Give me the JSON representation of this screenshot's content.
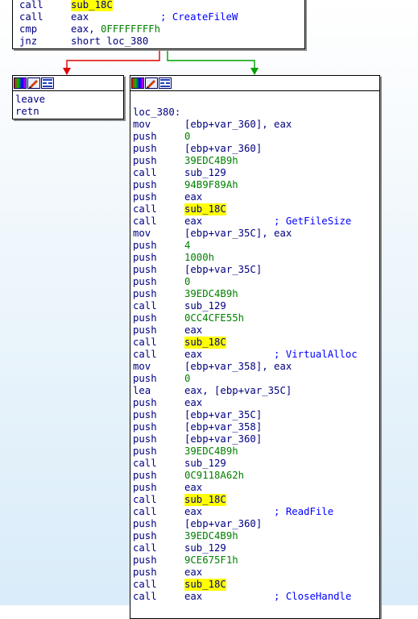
{
  "colors": {
    "false_edge": "#e00000",
    "true_edge": "#00a000",
    "highlight": "#ffff00",
    "mnemonic": "#000080",
    "number": "#008000",
    "comment": "#0000ff"
  },
  "header_icons": [
    "color-palette-icon",
    "edit-node-icon",
    "graph-view-icon"
  ],
  "top_block": {
    "lines": [
      {
        "mn": "call",
        "parts": [
          {
            "t": "sub_18C",
            "c": "hl"
          }
        ]
      },
      {
        "mn": "call",
        "parts": [
          {
            "t": "eax",
            "c": "op"
          },
          {
            "t": "            ; CreateFileW",
            "c": "cmt"
          }
        ]
      },
      {
        "mn": "cmp",
        "parts": [
          {
            "t": "eax, ",
            "c": "op"
          },
          {
            "t": "0FFFFFFFFh",
            "c": "num"
          }
        ]
      },
      {
        "mn": "jnz",
        "parts": [
          {
            "t": "short loc_380",
            "c": "op"
          }
        ]
      }
    ]
  },
  "left_block": {
    "lines": [
      {
        "mn": "leave",
        "parts": []
      },
      {
        "mn": "retn",
        "parts": []
      }
    ]
  },
  "right_block": {
    "lines": [
      {
        "mn": "",
        "parts": []
      },
      {
        "mn": "loc_380:",
        "parts": []
      },
      {
        "mn": "mov",
        "parts": [
          {
            "t": "[ebp+var_360], eax",
            "c": "op"
          }
        ]
      },
      {
        "mn": "push",
        "parts": [
          {
            "t": "0",
            "c": "num"
          }
        ]
      },
      {
        "mn": "push",
        "parts": [
          {
            "t": "[ebp+var_360]",
            "c": "op"
          }
        ]
      },
      {
        "mn": "push",
        "parts": [
          {
            "t": "39EDC4B9h",
            "c": "num"
          }
        ]
      },
      {
        "mn": "call",
        "parts": [
          {
            "t": "sub_129",
            "c": "op"
          }
        ]
      },
      {
        "mn": "push",
        "parts": [
          {
            "t": "94B9F89Ah",
            "c": "num"
          }
        ]
      },
      {
        "mn": "push",
        "parts": [
          {
            "t": "eax",
            "c": "op"
          }
        ]
      },
      {
        "mn": "call",
        "parts": [
          {
            "t": "sub_18C",
            "c": "hl"
          }
        ]
      },
      {
        "mn": "call",
        "parts": [
          {
            "t": "eax",
            "c": "op"
          },
          {
            "t": "            ; GetFileSize",
            "c": "cmt"
          }
        ]
      },
      {
        "mn": "mov",
        "parts": [
          {
            "t": "[ebp+var_35C], eax",
            "c": "op"
          }
        ]
      },
      {
        "mn": "push",
        "parts": [
          {
            "t": "4",
            "c": "num"
          }
        ]
      },
      {
        "mn": "push",
        "parts": [
          {
            "t": "1000h",
            "c": "num"
          }
        ]
      },
      {
        "mn": "push",
        "parts": [
          {
            "t": "[ebp+var_35C]",
            "c": "op"
          }
        ]
      },
      {
        "mn": "push",
        "parts": [
          {
            "t": "0",
            "c": "num"
          }
        ]
      },
      {
        "mn": "push",
        "parts": [
          {
            "t": "39EDC4B9h",
            "c": "num"
          }
        ]
      },
      {
        "mn": "call",
        "parts": [
          {
            "t": "sub_129",
            "c": "op"
          }
        ]
      },
      {
        "mn": "push",
        "parts": [
          {
            "t": "0CC4CFE55h",
            "c": "num"
          }
        ]
      },
      {
        "mn": "push",
        "parts": [
          {
            "t": "eax",
            "c": "op"
          }
        ]
      },
      {
        "mn": "call",
        "parts": [
          {
            "t": "sub_18C",
            "c": "hl"
          }
        ]
      },
      {
        "mn": "call",
        "parts": [
          {
            "t": "eax",
            "c": "op"
          },
          {
            "t": "            ; VirtualAlloc",
            "c": "cmt"
          }
        ]
      },
      {
        "mn": "mov",
        "parts": [
          {
            "t": "[ebp+var_358], eax",
            "c": "op"
          }
        ]
      },
      {
        "mn": "push",
        "parts": [
          {
            "t": "0",
            "c": "num"
          }
        ]
      },
      {
        "mn": "lea",
        "parts": [
          {
            "t": "eax, [ebp+var_35C]",
            "c": "op"
          }
        ]
      },
      {
        "mn": "push",
        "parts": [
          {
            "t": "eax",
            "c": "op"
          }
        ]
      },
      {
        "mn": "push",
        "parts": [
          {
            "t": "[ebp+var_35C]",
            "c": "op"
          }
        ]
      },
      {
        "mn": "push",
        "parts": [
          {
            "t": "[ebp+var_358]",
            "c": "op"
          }
        ]
      },
      {
        "mn": "push",
        "parts": [
          {
            "t": "[ebp+var_360]",
            "c": "op"
          }
        ]
      },
      {
        "mn": "push",
        "parts": [
          {
            "t": "39EDC4B9h",
            "c": "num"
          }
        ]
      },
      {
        "mn": "call",
        "parts": [
          {
            "t": "sub_129",
            "c": "op"
          }
        ]
      },
      {
        "mn": "push",
        "parts": [
          {
            "t": "0C9118A62h",
            "c": "num"
          }
        ]
      },
      {
        "mn": "push",
        "parts": [
          {
            "t": "eax",
            "c": "op"
          }
        ]
      },
      {
        "mn": "call",
        "parts": [
          {
            "t": "sub_18C",
            "c": "hl"
          }
        ]
      },
      {
        "mn": "call",
        "parts": [
          {
            "t": "eax",
            "c": "op"
          },
          {
            "t": "            ; ReadFile",
            "c": "cmt"
          }
        ]
      },
      {
        "mn": "push",
        "parts": [
          {
            "t": "[ebp+var_360]",
            "c": "op"
          }
        ]
      },
      {
        "mn": "push",
        "parts": [
          {
            "t": "39EDC4B9h",
            "c": "num"
          }
        ]
      },
      {
        "mn": "call",
        "parts": [
          {
            "t": "sub_129",
            "c": "op"
          }
        ]
      },
      {
        "mn": "push",
        "parts": [
          {
            "t": "9CE675F1h",
            "c": "num"
          }
        ]
      },
      {
        "mn": "push",
        "parts": [
          {
            "t": "eax",
            "c": "op"
          }
        ]
      },
      {
        "mn": "call",
        "parts": [
          {
            "t": "sub_18C",
            "c": "hl"
          }
        ]
      },
      {
        "mn": "call",
        "parts": [
          {
            "t": "eax",
            "c": "op"
          },
          {
            "t": "            ; CloseHandle",
            "c": "cmt"
          }
        ]
      }
    ]
  }
}
